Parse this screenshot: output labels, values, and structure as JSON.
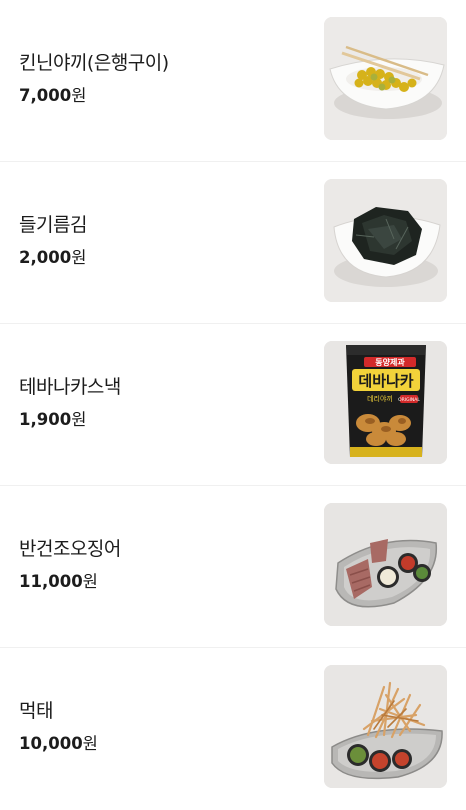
{
  "menu": {
    "items": [
      {
        "name": "킨닌야끼(은행구이)",
        "price": "7,000",
        "currency": "원",
        "photo": "ginkgo-skewer-dish"
      },
      {
        "name": "들기름김",
        "price": "2,000",
        "currency": "원",
        "photo": "seasoned-laver-dish"
      },
      {
        "name": "테바나카스낵",
        "price": "1,900",
        "currency": "원",
        "photo": "snack-bag",
        "photo_text": {
          "brand": "동양제과",
          "title": "데바나카",
          "sub": "데리야끼",
          "tag": "ORIGINAL"
        }
      },
      {
        "name": "반건조오징어",
        "price": "11,000",
        "currency": "원",
        "photo": "dried-squid-platter"
      },
      {
        "name": "먹태",
        "price": "10,000",
        "currency": "원",
        "photo": "dried-pollock-platter"
      }
    ]
  }
}
